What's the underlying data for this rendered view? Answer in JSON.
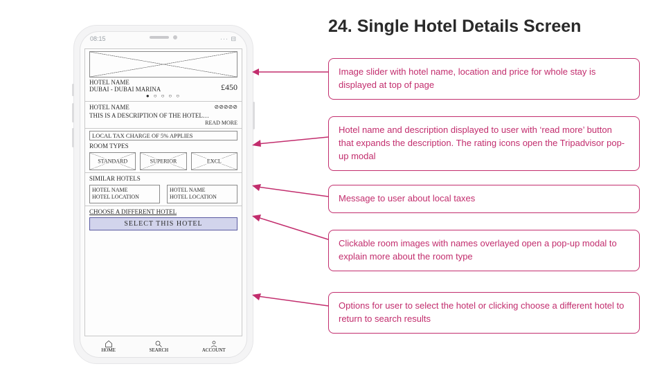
{
  "title": "24. Single Hotel Details Screen",
  "status": {
    "time": "08:15",
    "indicators": "···  ⊟"
  },
  "slider": {
    "hotel_name": "HOTEL NAME",
    "location": "DUBAI - DUBAI MARINA",
    "price": "£450",
    "dots": "● ○ ○ ○ ○"
  },
  "desc": {
    "name": "HOTEL NAME",
    "rating": "⊘⊘⊘⊘⊘",
    "text": "THIS IS A DESCRIPTION OF THE HOTEL…",
    "readmore": "READ MORE"
  },
  "tax": {
    "msg": "LOCAL TAX CHARGE OF 5% APPLIES",
    "rooms_heading": "ROOM TYPES",
    "rooms": [
      "STANDARD",
      "SUPERIOR",
      "EXCL"
    ]
  },
  "similar": {
    "heading": "SIMILAR HOTELS",
    "items": [
      {
        "name": "HOTEL NAME",
        "loc": "HOTEL LOCATION"
      },
      {
        "name": "HOTEL NAME",
        "loc": "HOTEL LOCATION"
      }
    ]
  },
  "actions": {
    "choose": "CHOOSE A DIFFERENT HOTEL",
    "select": "SELECT THIS HOTEL"
  },
  "tabs": {
    "home": "HOME",
    "search": "SEARCH",
    "account": "ACCOUNT"
  },
  "callouts": [
    "Image slider with hotel name, location and price for whole stay is displayed at top of page",
    "Hotel name and description displayed to user with ‘read more’ button that expands the description. The rating icons open the Tripadvisor pop-up modal",
    "Message to user about local taxes",
    "Clickable room images with names overlayed open a pop-up modal to explain more about the room type",
    "Options for user to select the hotel or clicking choose a different hotel to return to search results"
  ],
  "colors": {
    "accent": "#c22d6d"
  }
}
